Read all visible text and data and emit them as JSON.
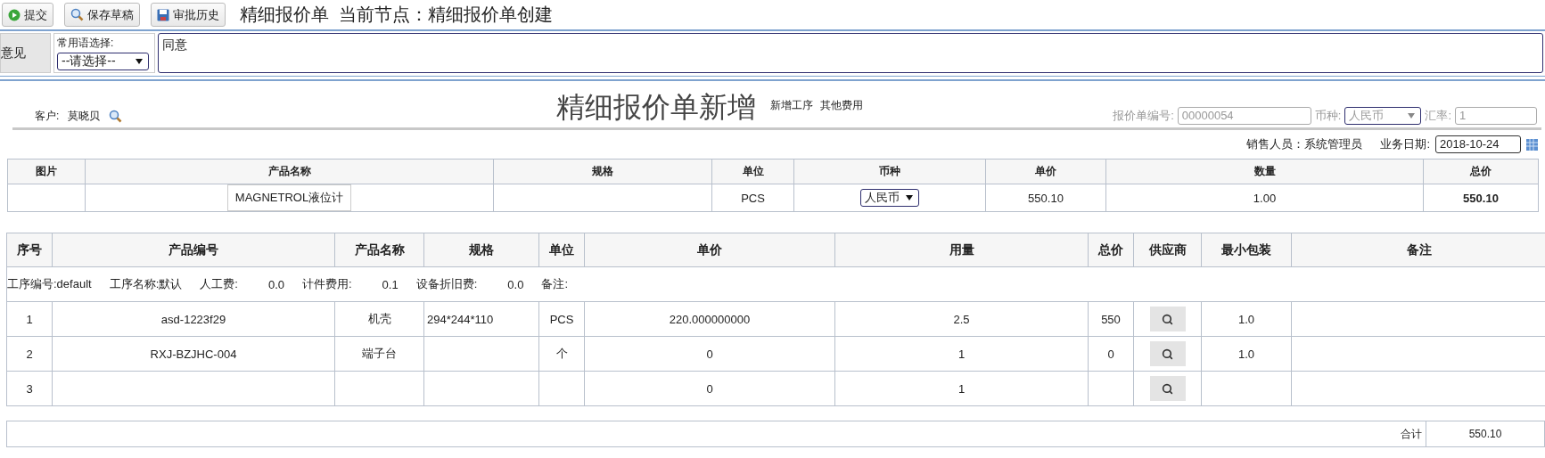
{
  "toolbar": {
    "buttons": [
      {
        "kind": "submit",
        "label": "提交"
      },
      {
        "kind": "search",
        "label": "保存草稿"
      },
      {
        "kind": "save",
        "label": "审批历史"
      }
    ],
    "title": "精细报价单  当前节点：精细报价单创建"
  },
  "opinion": {
    "label": "意见",
    "phrase_label": "常用语选择:",
    "phrase_select": "--请选择--",
    "text": "同意"
  },
  "header": {
    "title": "精细报价单新增",
    "customer_label": "客户:",
    "customer": "莫晓贝",
    "links": [
      "新增工序",
      "其他费用"
    ],
    "quote_no_label": "报价单编号:",
    "quote_no": "00000054",
    "currency_label": "币种:",
    "currency": "人民币",
    "rate_label": "汇率:",
    "rate": "1",
    "salesperson": "销售人员：系统管理员",
    "date_label": "业务日期:",
    "date": "2018-10-24"
  },
  "product_table": {
    "columns": [
      "图片",
      "产品名称",
      "规格",
      "单位",
      "币种",
      "单价",
      "数量",
      "总价"
    ],
    "row": {
      "name": "MAGNETROL液位计",
      "unit": "PCS",
      "currency": "人民币",
      "price": "550.10",
      "qty": "1.00",
      "total": "550.10"
    }
  },
  "detail_table": {
    "columns": [
      "序号",
      "产品编号",
      "产品名称",
      "规格",
      "单位",
      "单价",
      "用量",
      "总价",
      "供应商",
      "最小包装",
      "备注"
    ],
    "process": [
      "工序编号:default",
      "工序名称:默认",
      "人工费:",
      "0.0",
      "计件费用:",
      "0.1",
      "设备折旧费:",
      "0.0",
      "备注:"
    ],
    "rows": [
      {
        "no": "1",
        "code": "asd-1223f29",
        "name": "机壳",
        "spec": "294*244*110",
        "unit": "PCS",
        "price": "220.000000000",
        "qty": "2.5",
        "total": "550",
        "min_pack": "1.0"
      },
      {
        "no": "2",
        "code": "RXJ-BZJHC-004",
        "name": "端子台",
        "unit": "个",
        "price": "0",
        "qty": "1",
        "total": "0",
        "min_pack": "1.0"
      },
      {
        "no": "3",
        "price": "0",
        "qty": "1"
      }
    ]
  },
  "summary": {
    "label": "合计",
    "value": "550.10"
  }
}
